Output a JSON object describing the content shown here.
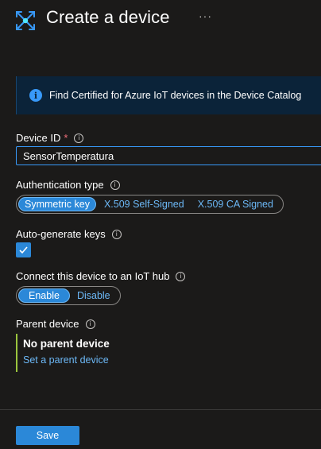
{
  "header": {
    "title": "Create a device",
    "more_icon": "ellipsis-icon",
    "icon": "iot-hub-icon"
  },
  "infobar": {
    "icon": "info-icon",
    "text": "Find Certified for Azure IoT devices in the Device Catalog"
  },
  "device_id": {
    "label": "Device ID",
    "required_mark": "*",
    "value": "SensorTemperatura"
  },
  "auth_type": {
    "label": "Authentication type",
    "options": [
      "Symmetric key",
      "X.509 Self-Signed",
      "X.509 CA Signed"
    ],
    "selected": "Symmetric key"
  },
  "auto_keys": {
    "label": "Auto-generate keys",
    "checked": true
  },
  "connect_hub": {
    "label": "Connect this device to an IoT hub",
    "options": [
      "Enable",
      "Disable"
    ],
    "selected": "Enable"
  },
  "parent_device": {
    "label": "Parent device",
    "value": "No parent device",
    "link": "Set a parent device"
  },
  "footer": {
    "save_label": "Save"
  },
  "colors": {
    "accent": "#2b88d8",
    "link": "#6cb8f6",
    "background": "#1b1a19",
    "parent_bar": "#9bc53d"
  }
}
